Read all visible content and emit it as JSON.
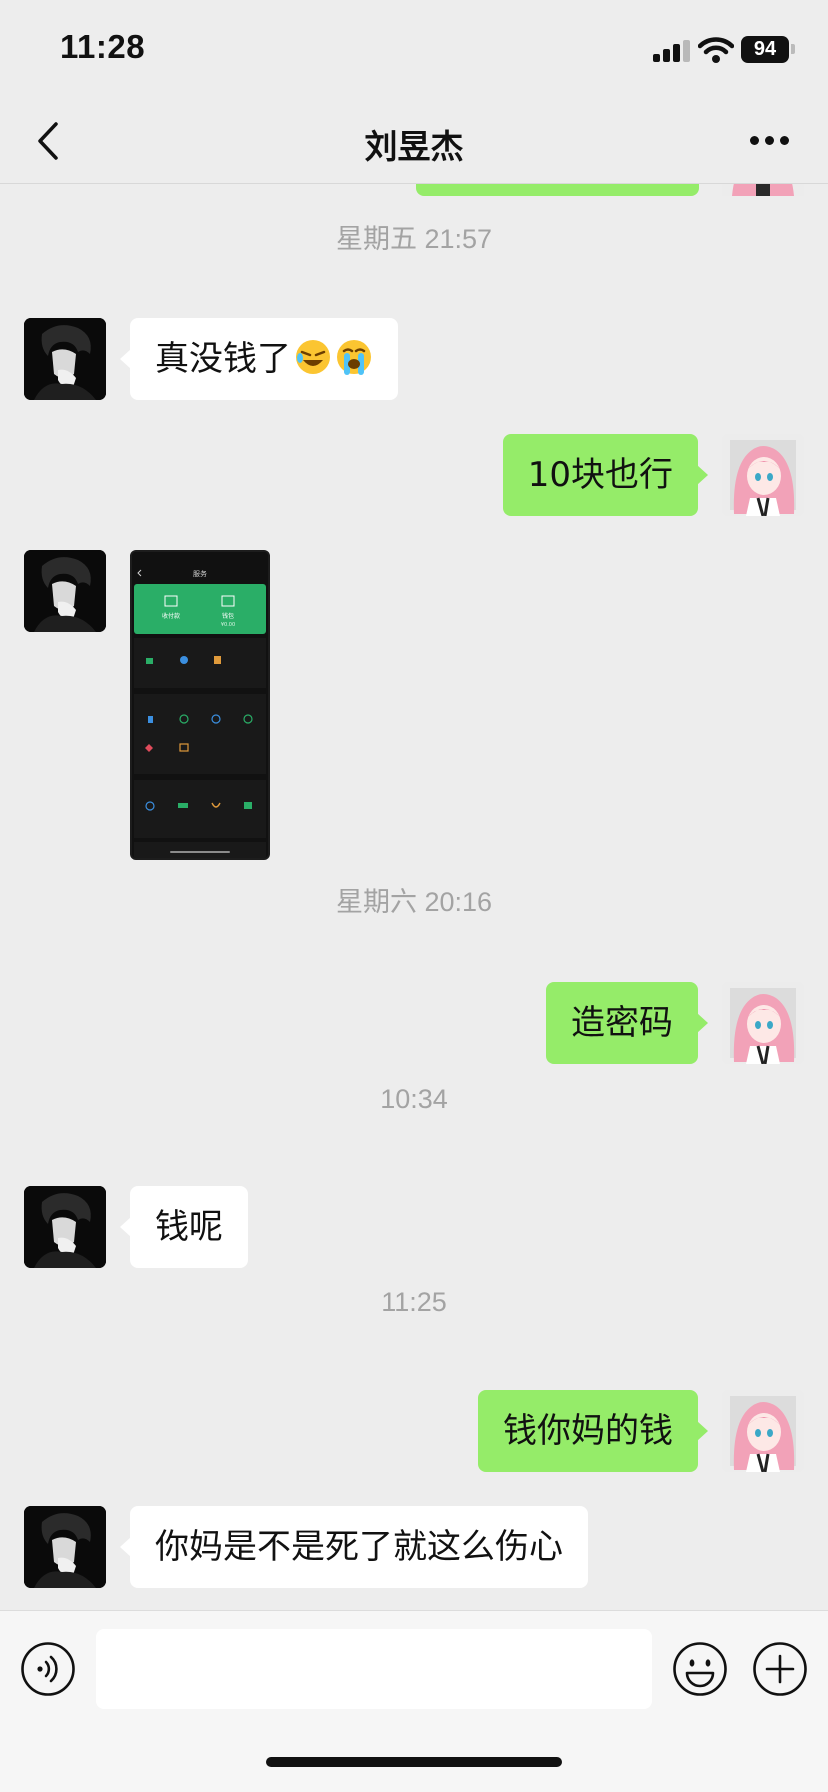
{
  "status_bar": {
    "time": "11:28",
    "battery": "94"
  },
  "header": {
    "title": "刘昱杰"
  },
  "messages": {
    "ts1": "星期五 21:57",
    "m1": "真没钱了",
    "m2": "10块也行",
    "ts2": "星期六 20:16",
    "m3": "造密码",
    "ts3": "10:34",
    "m4": "钱呢",
    "ts4": "11:25",
    "m5": "钱你妈的钱",
    "m6": "你妈是不是死了就这么伤心"
  },
  "screenshot_image": {
    "header": "服务",
    "pay_label": "收付款",
    "wallet_label": "钱包",
    "wallet_balance": "¥0.00"
  },
  "input": {
    "value": ""
  },
  "colors": {
    "outgoing": "#95ec69",
    "incoming": "#ffffff",
    "background": "#ededed",
    "wechat_green": "#2aae67"
  }
}
